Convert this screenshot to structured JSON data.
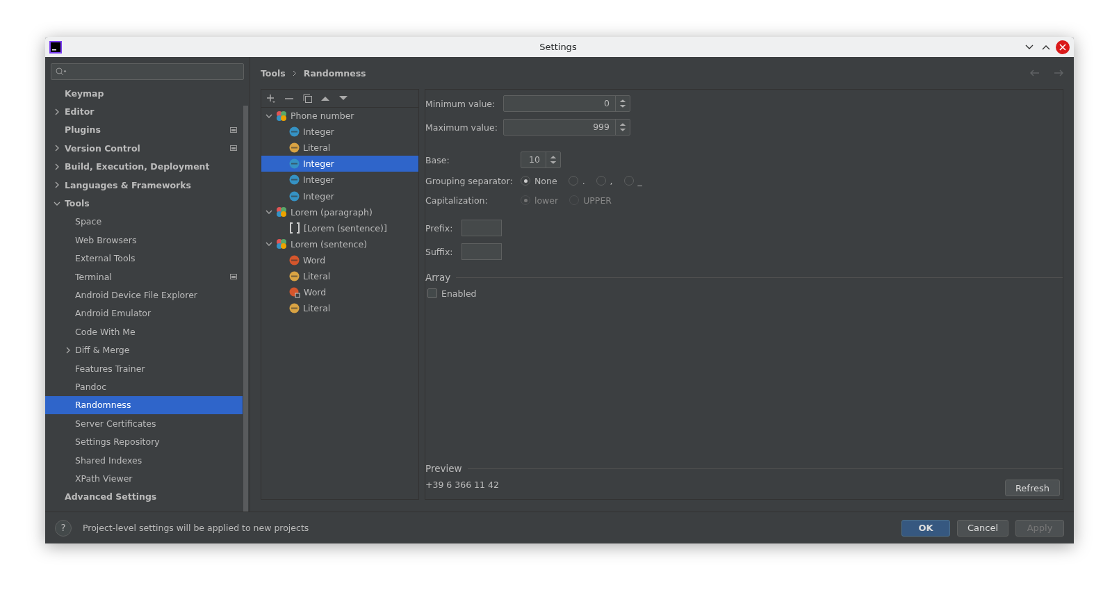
{
  "window": {
    "title": "Settings"
  },
  "sidebar": {
    "items": [
      {
        "label": "Keymap",
        "expandable": false,
        "expanded": false,
        "selected": false,
        "project_level": false
      },
      {
        "label": "Editor",
        "expandable": true,
        "expanded": false,
        "selected": false,
        "project_level": false
      },
      {
        "label": "Plugins",
        "expandable": false,
        "expanded": false,
        "selected": false,
        "project_level": true
      },
      {
        "label": "Version Control",
        "expandable": true,
        "expanded": false,
        "selected": false,
        "project_level": true
      },
      {
        "label": "Build, Execution, Deployment",
        "expandable": true,
        "expanded": false,
        "selected": false,
        "project_level": false
      },
      {
        "label": "Languages & Frameworks",
        "expandable": true,
        "expanded": false,
        "selected": false,
        "project_level": false
      },
      {
        "label": "Tools",
        "expandable": true,
        "expanded": true,
        "selected": false,
        "project_level": false,
        "children": [
          {
            "label": "Space",
            "expandable": false,
            "expanded": false,
            "selected": false,
            "project_level": false
          },
          {
            "label": "Web Browsers",
            "expandable": false,
            "expanded": false,
            "selected": false,
            "project_level": false
          },
          {
            "label": "External Tools",
            "expandable": false,
            "expanded": false,
            "selected": false,
            "project_level": false
          },
          {
            "label": "Terminal",
            "expandable": false,
            "expanded": false,
            "selected": false,
            "project_level": true
          },
          {
            "label": "Android Device File Explorer",
            "expandable": false,
            "expanded": false,
            "selected": false,
            "project_level": false
          },
          {
            "label": "Android Emulator",
            "expandable": false,
            "expanded": false,
            "selected": false,
            "project_level": false
          },
          {
            "label": "Code With Me",
            "expandable": false,
            "expanded": false,
            "selected": false,
            "project_level": false
          },
          {
            "label": "Diff & Merge",
            "expandable": true,
            "expanded": false,
            "selected": false,
            "project_level": false
          },
          {
            "label": "Features Trainer",
            "expandable": false,
            "expanded": false,
            "selected": false,
            "project_level": false
          },
          {
            "label": "Pandoc",
            "expandable": false,
            "expanded": false,
            "selected": false,
            "project_level": false
          },
          {
            "label": "Randomness",
            "expandable": false,
            "expanded": false,
            "selected": true,
            "project_level": false
          },
          {
            "label": "Server Certificates",
            "expandable": false,
            "expanded": false,
            "selected": false,
            "project_level": false
          },
          {
            "label": "Settings Repository",
            "expandable": false,
            "expanded": false,
            "selected": false,
            "project_level": false
          },
          {
            "label": "Shared Indexes",
            "expandable": false,
            "expanded": false,
            "selected": false,
            "project_level": false
          },
          {
            "label": "XPath Viewer",
            "expandable": false,
            "expanded": false,
            "selected": false,
            "project_level": false
          }
        ]
      },
      {
        "label": "Advanced Settings",
        "expandable": false,
        "expanded": false,
        "selected": false,
        "project_level": false
      }
    ]
  },
  "breadcrumb": [
    "Tools",
    "Randomness"
  ],
  "tree": [
    {
      "label": "Phone number",
      "kind": "template",
      "expanded": true,
      "selected": false,
      "children": [
        {
          "label": "Integer",
          "kind": "integer",
          "selected": false
        },
        {
          "label": "Literal",
          "kind": "literal",
          "selected": false
        },
        {
          "label": "Integer",
          "kind": "integer",
          "selected": true
        },
        {
          "label": "Integer",
          "kind": "integer",
          "selected": false
        },
        {
          "label": "Integer",
          "kind": "integer",
          "selected": false
        }
      ]
    },
    {
      "label": "Lorem (paragraph)",
      "kind": "template",
      "expanded": true,
      "selected": false,
      "children": [
        {
          "label": "[Lorem (sentence)]",
          "kind": "reference",
          "selected": false
        }
      ]
    },
    {
      "label": "Lorem (sentence)",
      "kind": "template",
      "expanded": true,
      "selected": false,
      "children": [
        {
          "label": "Word",
          "kind": "word",
          "selected": false
        },
        {
          "label": "Literal",
          "kind": "literal",
          "selected": false
        },
        {
          "label": "Word",
          "kind": "word-array",
          "selected": false
        },
        {
          "label": "Literal",
          "kind": "literal",
          "selected": false
        }
      ]
    }
  ],
  "form": {
    "minimum": {
      "label": "Minimum value:",
      "value": "0"
    },
    "maximum": {
      "label": "Maximum value:",
      "value": "999"
    },
    "base": {
      "label": "Base:",
      "value": "10"
    },
    "grouping": {
      "label": "Grouping separator:",
      "disabled": false,
      "options": [
        {
          "label": "None",
          "selected": true
        },
        {
          "label": ".",
          "selected": false
        },
        {
          "label": ",",
          "selected": false
        },
        {
          "label": "_",
          "selected": false
        }
      ]
    },
    "capitalization": {
      "label": "Capitalization:",
      "disabled": true,
      "options": [
        {
          "label": "lower",
          "selected": true
        },
        {
          "label": "UPPER",
          "selected": false
        }
      ]
    },
    "prefix": {
      "label": "Prefix:"
    },
    "suffix": {
      "label": "Suffix:"
    },
    "array": {
      "title": "Array",
      "enabled_label": "Enabled",
      "checked": false
    },
    "preview": {
      "title": "Preview",
      "text": "+39 6 366 11 42",
      "button": "Refresh"
    }
  },
  "status": {
    "help": "?",
    "text": "Project-level settings will be applied to new projects"
  },
  "buttons": [
    {
      "label": "OK",
      "kind": "default"
    },
    {
      "label": "Cancel",
      "kind": "normal"
    },
    {
      "label": "Apply",
      "kind": "disabled"
    }
  ]
}
